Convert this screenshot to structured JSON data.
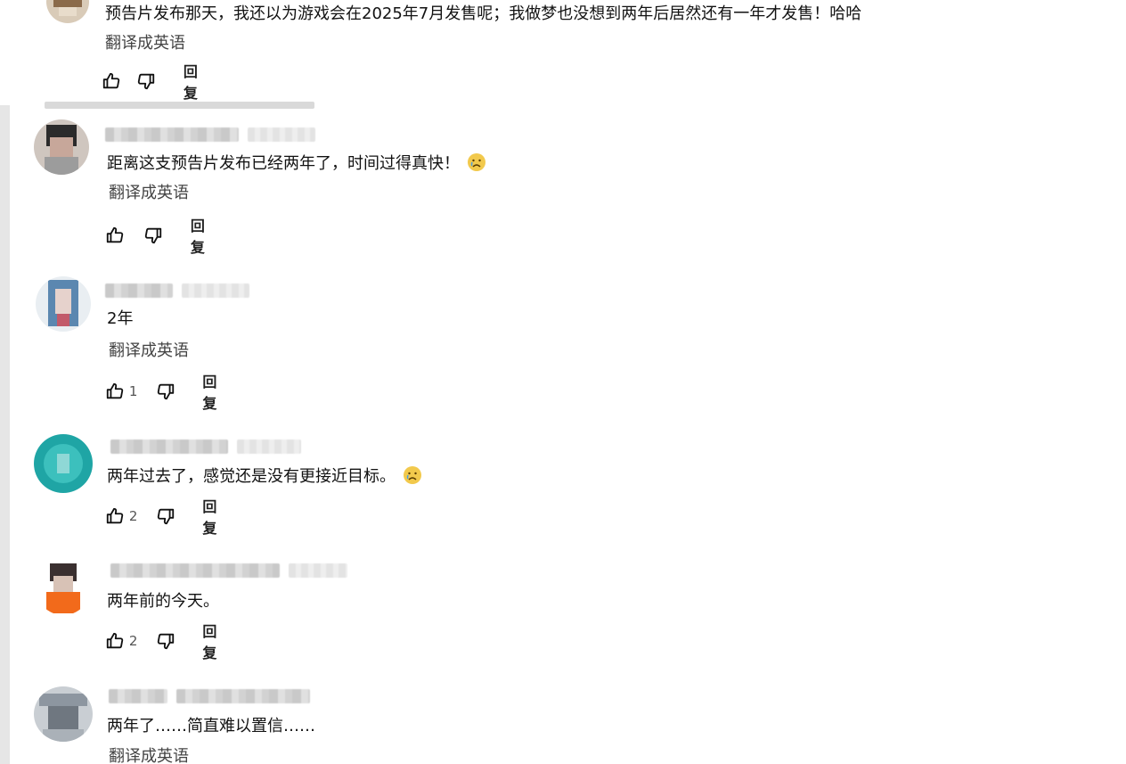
{
  "translate_label": "翻译成英语",
  "reply_label": "回复",
  "comments": [
    {
      "text": "预告片发布那天，我还以为游戏会在2025年7月发售呢；我做梦也没想到两年后居然还有一年才发售！哈哈",
      "translate": "翻译成英语",
      "likes": "",
      "reply": "回复"
    },
    {
      "text": "距离这支预告片发布已经两年了，时间过得真快！",
      "emoji": "crying-face-icon",
      "translate": "翻译成英语",
      "likes": "",
      "reply": "回复"
    },
    {
      "text": "2年",
      "translate": "翻译成英语",
      "likes": "1",
      "reply": "回复"
    },
    {
      "text": "两年过去了，感觉还是没有更接近目标。",
      "emoji": "crying-face-icon",
      "likes": "2",
      "reply": "回复"
    },
    {
      "text": "两年前的今天。",
      "likes": "2",
      "reply": "回复"
    },
    {
      "text": "两年了……简直难以置信……",
      "translate": "翻译成英语"
    }
  ],
  "colors": {
    "thread_line": "#e6e6e6",
    "emoji_face": "#f2c94c"
  }
}
